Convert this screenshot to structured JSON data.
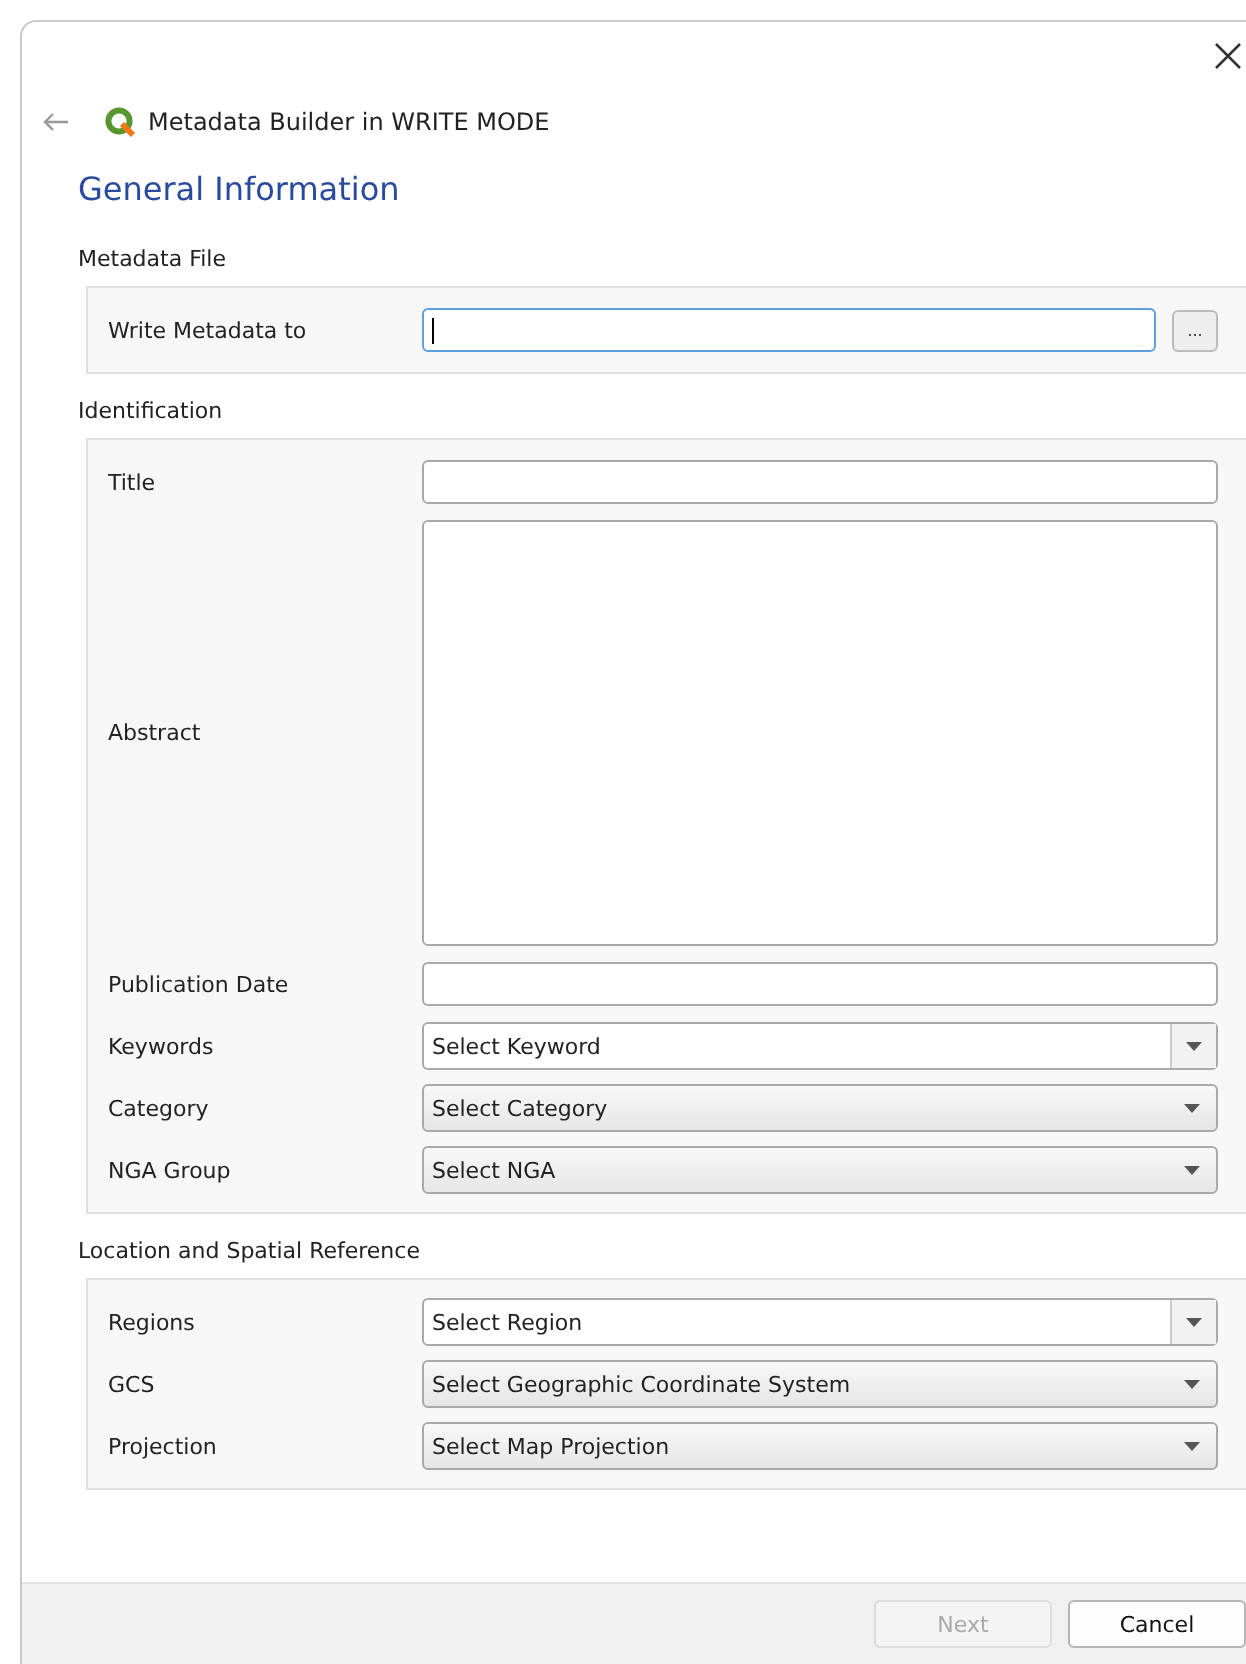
{
  "window": {
    "title": "Metadata Builder in WRITE MODE"
  },
  "page_title": "General Information",
  "sections": [
    {
      "heading": "Metadata File",
      "fields": [
        {
          "label": "Write Metadata to",
          "kind": "line",
          "focused": true,
          "browse": "..."
        }
      ]
    },
    {
      "heading": "Identification",
      "fields": [
        {
          "label": "Title",
          "kind": "line",
          "focused": false
        },
        {
          "label": "Abstract",
          "kind": "textarea",
          "focused": false
        },
        {
          "label": "Publication Date",
          "kind": "line",
          "focused": false
        },
        {
          "label": "Keywords",
          "kind": "editable",
          "value": "Select Keyword"
        },
        {
          "label": "Category",
          "kind": "select",
          "value": "Select Category"
        },
        {
          "label": "NGA Group",
          "kind": "select",
          "value": "Select NGA"
        }
      ]
    },
    {
      "heading": "Location and Spatial Reference",
      "fields": [
        {
          "label": "Regions",
          "kind": "editable",
          "value": "Select Region"
        },
        {
          "label": "GCS",
          "kind": "select",
          "value": "Select Geographic Coordinate System"
        },
        {
          "label": "Projection",
          "kind": "select",
          "value": "Select Map Projection"
        }
      ]
    }
  ],
  "buttons": [
    {
      "label": "Next",
      "disabled": true
    },
    {
      "label": "Cancel",
      "disabled": false
    }
  ]
}
